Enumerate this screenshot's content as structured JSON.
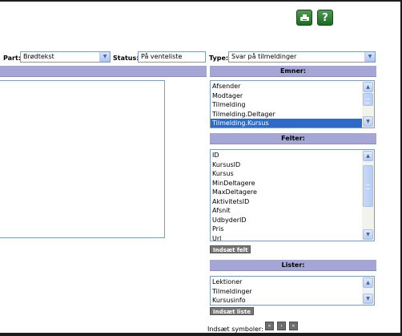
{
  "toolbar": {
    "print_icon": "printer-icon",
    "help_icon_glyph": "?",
    "part": {
      "label": "Part:",
      "value": "Brødtekst"
    },
    "status": {
      "label": "Status:",
      "value": "På venteliste"
    },
    "type": {
      "label": "Type:",
      "value": "Svar på tilmeldinger"
    }
  },
  "emner": {
    "header": "Emner:",
    "items": [
      "Afsender",
      "Modtager",
      "Tilmelding",
      "Tilmelding.Deltager",
      "Tilmelding.Kursus"
    ],
    "selected_index": 4
  },
  "felter": {
    "header": "Felter:",
    "items": [
      "ID",
      "KursusID",
      "Kursus",
      "MinDeltagere",
      "MaxDeltagere",
      "AktivitetsID",
      "Afsnit",
      "UdbyderID",
      "Pris",
      "Url"
    ],
    "insert_button": "Indsæt felt"
  },
  "lister": {
    "header": "Lister:",
    "items": [
      "Lektioner",
      "Tilmeldinger",
      "Kursusinfo"
    ],
    "insert_button": "Indsæt liste"
  },
  "symbols": {
    "label": "Indsæt symboler:",
    "buttons": [
      "«",
      "‹",
      "»"
    ]
  },
  "colors": {
    "header_bar": "#a6a6d6",
    "selection": "#316ac5",
    "icon_green": "#2f7d33"
  }
}
